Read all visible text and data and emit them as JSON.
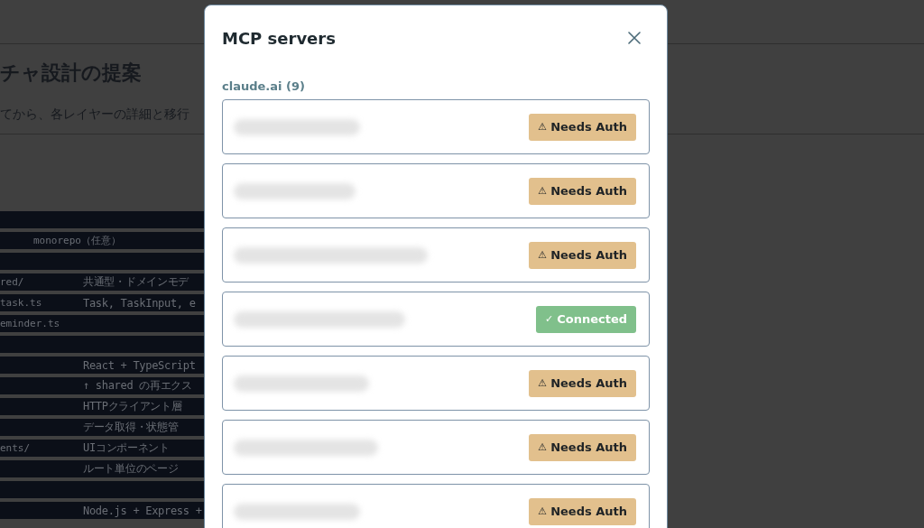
{
  "page": {
    "heading": "チャ設計の提案",
    "intro": "てから、各レイヤーの詳細と移行",
    "code_lines": [
      {
        "kind": "blank"
      },
      {
        "kind": "title",
        "left": "monorepo（任意）"
      },
      {
        "kind": "blank"
      },
      {
        "kind": "entry",
        "left": "red/",
        "right": "共通型・ドメインモデ"
      },
      {
        "kind": "entry",
        "left": "task.ts",
        "right": "Task, TaskInput, e"
      },
      {
        "kind": "entry",
        "left": "eminder.ts"
      },
      {
        "kind": "blank"
      },
      {
        "kind": "entry",
        "right": "React + TypeScript"
      },
      {
        "kind": "entry",
        "right": "↑ shared の再エクス"
      },
      {
        "kind": "entry",
        "right": "HTTPクライアント層"
      },
      {
        "kind": "entry",
        "right": "データ取得・状態管"
      },
      {
        "kind": "entry",
        "left": "ents/",
        "right": "UIコンポーネント"
      },
      {
        "kind": "entry",
        "right": "ルート単位のページ"
      },
      {
        "kind": "blank"
      },
      {
        "kind": "entry",
        "right": "Node.js + Express +"
      }
    ]
  },
  "dialog": {
    "title": "MCP servers",
    "section": "claude.ai (9)",
    "servers": [
      {
        "kind": "warning",
        "icon": "⚠",
        "badge": "Needs Auth"
      },
      {
        "kind": "warning",
        "icon": "⚠",
        "badge": "Needs Auth"
      },
      {
        "kind": "warning",
        "icon": "⚠",
        "badge": "Needs Auth"
      },
      {
        "kind": "success",
        "icon": "✓",
        "badge": "Connected"
      },
      {
        "kind": "warning",
        "icon": "⚠",
        "badge": "Needs Auth"
      },
      {
        "kind": "warning",
        "icon": "⚠",
        "badge": "Needs Auth"
      },
      {
        "kind": "warning",
        "icon": "⚠",
        "badge": "Needs Auth"
      }
    ]
  }
}
